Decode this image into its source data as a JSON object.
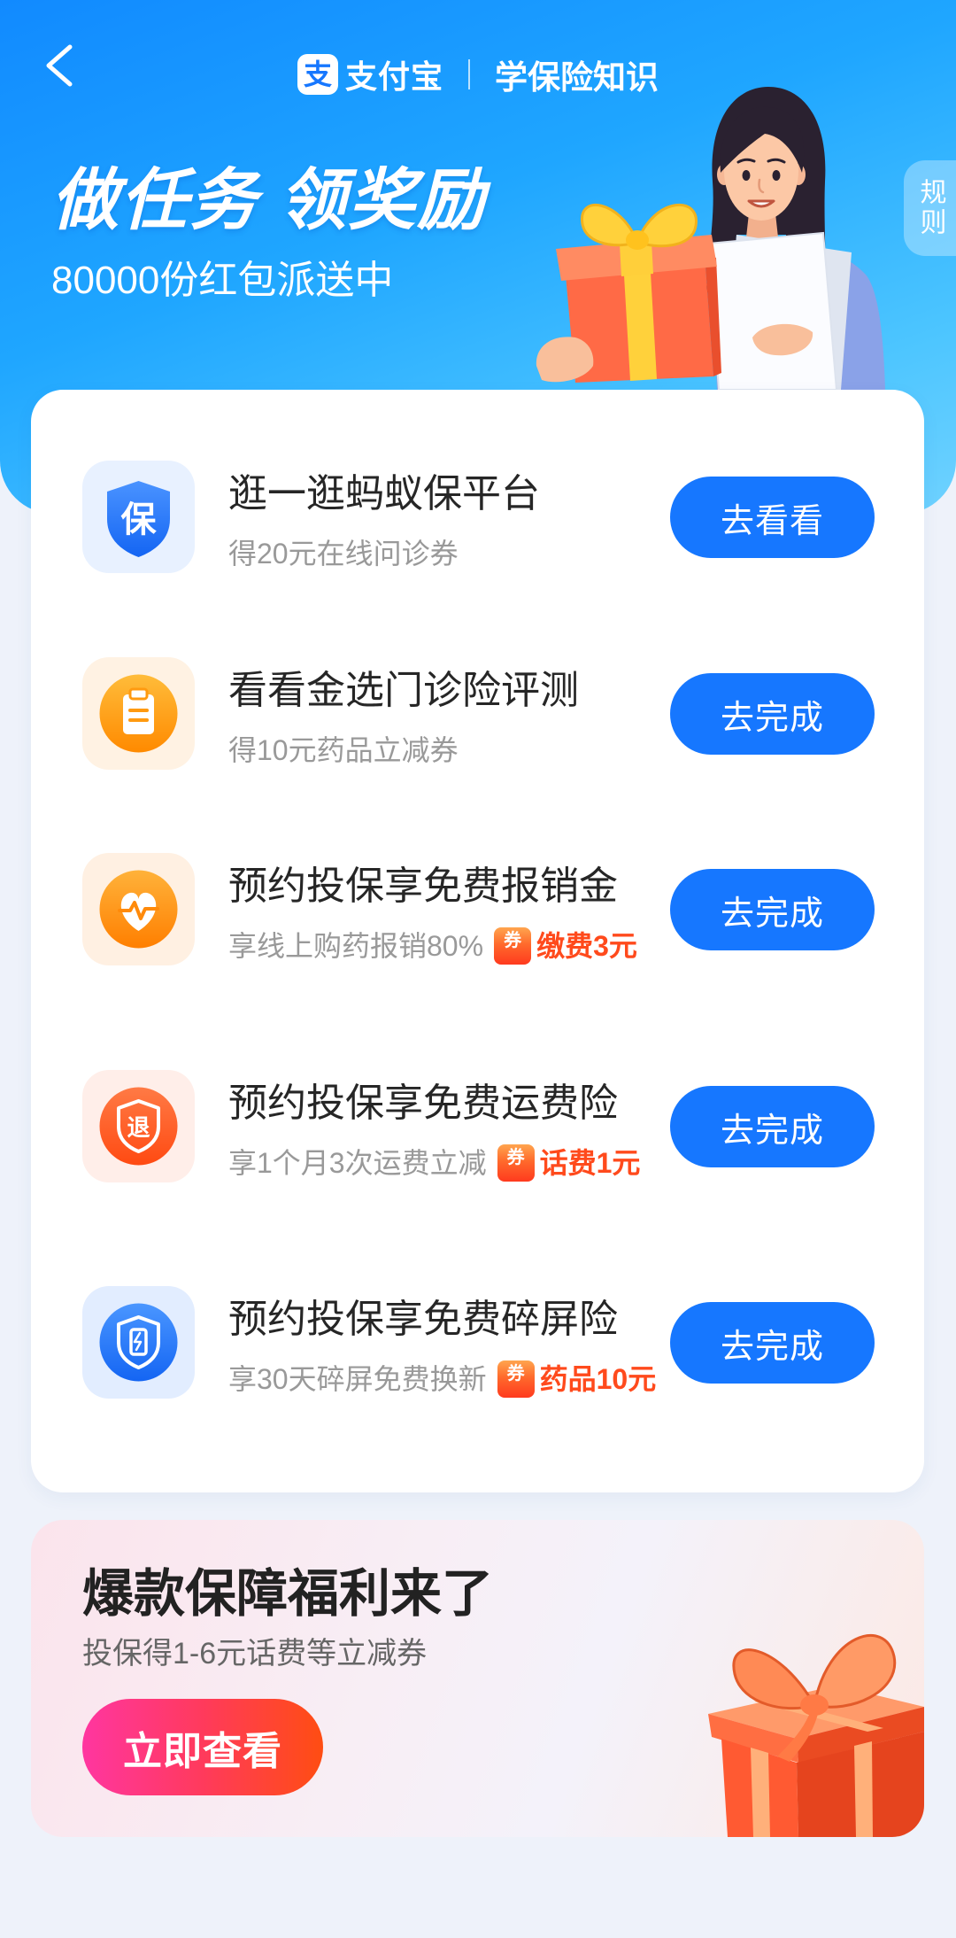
{
  "header": {
    "back_icon": "chevron-left-icon",
    "brand": {
      "logo_icon": "alipay-logo-icon",
      "logo_glyph": "支",
      "name": "支付宝"
    },
    "page_title": "学保险知识",
    "banner_title": "做任务 领奖励",
    "banner_subtitle": "80000份红包派送中",
    "rules_tab": "规则",
    "illustration": "woman-holding-gift-illustration"
  },
  "tasks": [
    {
      "icon": "shield-bao-icon",
      "icon_glyph": "保",
      "title": "逛一逛蚂蚁保平台",
      "subtitle": "得20元在线问诊券",
      "button": "去看看"
    },
    {
      "icon": "clipboard-icon",
      "title": "看看金选门诊险评测",
      "subtitle": "得10元药品立减券",
      "button": "去完成"
    },
    {
      "icon": "heart-pulse-icon",
      "title": "预约投保享免费报销金",
      "subtitle": "享线上购药报销80%",
      "coupon": {
        "icon": "coupon-ticket-icon",
        "icon_glyph": "券",
        "label": "缴费3元"
      },
      "button": "去完成"
    },
    {
      "icon": "return-shield-icon",
      "icon_glyph": "退",
      "title": "预约投保享免费运费险",
      "subtitle": "享1个月3次运费立减",
      "coupon": {
        "icon": "coupon-ticket-icon",
        "icon_glyph": "券",
        "label": "话费1元"
      },
      "button": "去完成"
    },
    {
      "icon": "phone-shield-icon",
      "title": "预约投保享免费碎屏险",
      "subtitle": "享30天碎屏免费换新",
      "coupon": {
        "icon": "coupon-ticket-icon",
        "icon_glyph": "券",
        "label": "药品10元"
      },
      "button": "去完成"
    }
  ],
  "promo": {
    "title": "爆款保障福利来了",
    "subtitle": "投保得1-6元话费等立减券",
    "button": "立即查看",
    "illustration": "gift-box-illustration"
  },
  "colors": {
    "header_blue": "#118aff",
    "header_cyan": "#4cc5ff",
    "button_blue": "#1677ff",
    "coupon_red": "#ff4a1c",
    "promo_button_start": "#ff36a0",
    "promo_button_end": "#ff4d12",
    "page_background": "#eef2fa"
  }
}
